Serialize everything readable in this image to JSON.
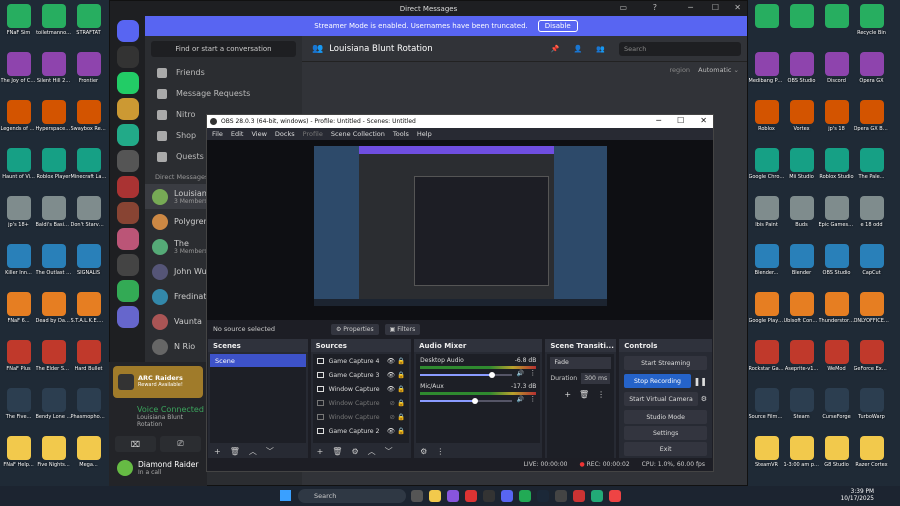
{
  "desktop_left": {
    "col1": [
      "FNaF Sim",
      "The Joy of Creation",
      "Legends of Grotesque",
      "Haunt of Vi...",
      "jp's 18+",
      "Killer Inn...",
      "FNaF 6...",
      "FNaF Plus",
      "The Five...",
      "FNaF Help..."
    ],
    "col2": [
      "toiletmanno...",
      "Silent Hill 2...",
      "Hyperspace Golfer",
      "Roblox Player",
      "Baldi's Basic...",
      "The Outlast Trials",
      "Dead by Daylight",
      "The Elder Scrolls V",
      "Bendy Lone Wolf",
      "Five Nights..."
    ],
    "col3": [
      "STRAFTAT",
      "Frontier",
      "Swaybox Reality",
      "Minecraft Launcher",
      "Don't Starve...",
      "SIGNALIS",
      "S.T.A.L.K.E.R. Heart of...",
      "Hard Bullet",
      "Phasmophobia",
      "Mega..."
    ]
  },
  "desktop_right": {
    "col1": [
      "",
      "Medibang Paint",
      "Roblox",
      "Google Chrome",
      "Ibis Paint",
      "Blender...",
      "Google Play Games beta",
      "Rockstar Games...",
      "Source Filmmaker",
      "SteamVR"
    ],
    "col2": [
      "",
      "OBS Studio",
      "Vortex",
      "Mii Studio",
      "Buds",
      "Blender",
      "Ubisoft Connect",
      "Aseprite-v1...",
      "Steam",
      "1-3:00 am print"
    ],
    "col3": [
      "",
      "Discord",
      "jp's 18",
      "Roblox Studio",
      "Epic Games Launcher",
      "OBS Studio",
      "Thunderstore Mod Mana...",
      "WeMod",
      "CurseForge",
      "G8 Studio"
    ],
    "col4": [
      "Recycle Bin",
      "Opera GX",
      "Opera GX Browser",
      "The Pale...",
      "e 18 odd",
      "CapCut",
      "ONLYOFFICE Editors",
      "GeForce Experience",
      "TurboWarp",
      "Razer Cortex"
    ]
  },
  "discord": {
    "window_title": "Direct Messages",
    "banner_text": "Streamer Mode is enabled. Usernames have been truncated.",
    "banner_button": "Disable",
    "search_conversation": "Find or start a conversation",
    "nav": [
      "Friends",
      "Message Requests",
      "Nitro",
      "Shop",
      "Quests"
    ],
    "dm_header": "Direct Messages",
    "dms": [
      {
        "name": "Louisiana",
        "sub": "3 Members"
      },
      {
        "name": "Polygren",
        "sub": ""
      },
      {
        "name": "The",
        "sub": "3 Members"
      },
      {
        "name": "John Wu",
        "sub": ""
      },
      {
        "name": "Fredinat",
        "sub": ""
      },
      {
        "name": "Vaunta",
        "sub": ""
      },
      {
        "name": "N Rio",
        "sub": ""
      }
    ],
    "channel_title": "Louisiana Blunt Rotation",
    "search_placeholder": "Search",
    "region_label": "region",
    "region_value": "Automatic",
    "promo_line1": "ARC Raiders",
    "promo_line2": "Reward Available!",
    "voice_status": "Voice Connected",
    "voice_channel": "Louisiana Blunt Rotation",
    "user_name": "Diamond Raider",
    "user_status": "In a call",
    "colors": {
      "blurple": "#5865f2",
      "green": "#3ba55d"
    }
  },
  "obs": {
    "title": "OBS 28.0.3 (64-bit, windows) - Profile: Untitled - Scenes: Untitled",
    "menu": [
      "File",
      "Edit",
      "View",
      "Docks",
      "Profile",
      "Scene Collection",
      "Tools",
      "Help"
    ],
    "no_source": "No source selected",
    "properties": "Properties",
    "filters": "Filters",
    "scenes_header": "Scenes",
    "scenes": [
      "Scene"
    ],
    "sources_header": "Sources",
    "sources": [
      {
        "name": "Game Capture 4",
        "active": true
      },
      {
        "name": "Game Capture 3",
        "active": true
      },
      {
        "name": "Window Capture",
        "active": true
      },
      {
        "name": "Window Capture",
        "active": false
      },
      {
        "name": "Window Capture",
        "active": false
      },
      {
        "name": "Game Capture 2",
        "active": true
      }
    ],
    "mixer_header": "Audio Mixer",
    "mixer": [
      {
        "name": "Desktop Audio",
        "db": "-6.8 dB",
        "level": 0.78
      },
      {
        "name": "Mic/Aux",
        "db": "-17.3 dB",
        "level": 0.6
      }
    ],
    "transitions_header": "Scene Transiti...",
    "transition": "Fade",
    "duration_label": "Duration",
    "duration_value": "300 ms",
    "controls_header": "Controls",
    "controls": [
      "Start Streaming",
      "Stop Recording",
      "Start Virtual Camera",
      "Studio Mode",
      "Settings",
      "Exit"
    ],
    "status_live": "LIVE: 00:00:00",
    "status_rec": "REC: 00:00:02",
    "status_cpu": "CPU: 1.0%, 60.00 fps"
  },
  "taskbar": {
    "search": "Search",
    "time": "3:39 PM",
    "date": "10/17/2025"
  }
}
